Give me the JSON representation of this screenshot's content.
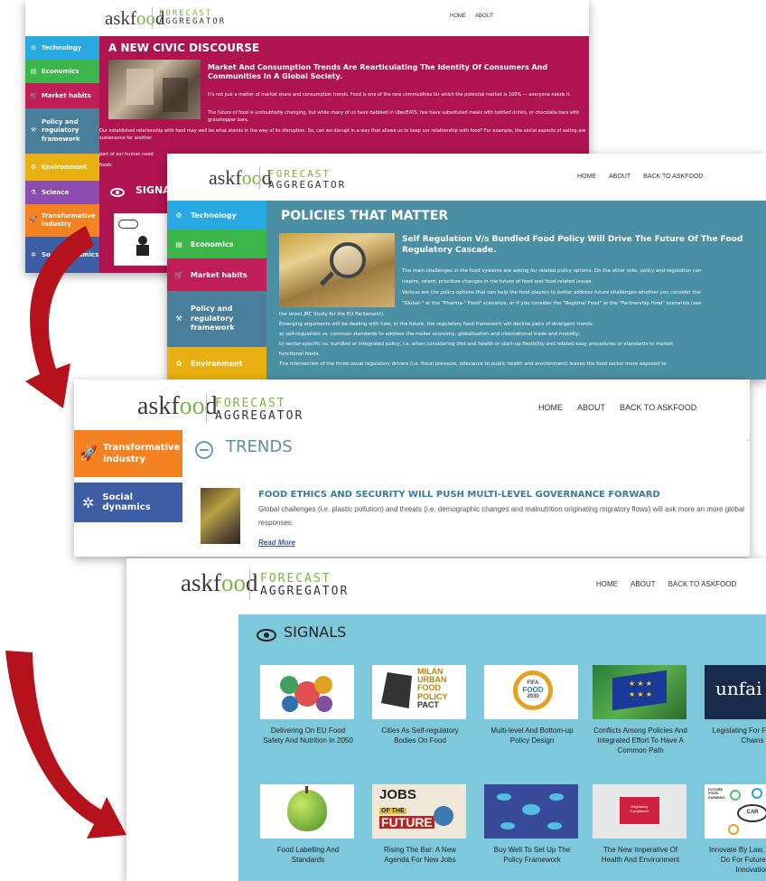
{
  "brand": {
    "ask": "askf",
    "oo": "oo",
    "d": "d",
    "forecast": "FORECAST",
    "aggregator": "AGGREGATOR"
  },
  "nav1": [
    "HOME",
    "ABOUT"
  ],
  "nav": [
    "HOME",
    "ABOUT",
    "BACK TO ASKFOOD"
  ],
  "colors": {
    "civic_bg": "#b01450",
    "policies_bg": "#4a8fa3",
    "signals_bg": "#7ec8dc",
    "tech": "#29a9e1",
    "economics": "#3cb54a",
    "market": "#bf1e56",
    "policy": "#4a7f9c",
    "environment": "#e8b010",
    "science": "#8d4cb0",
    "transform": "#f58220",
    "social": "#3d5da5",
    "arrow": "#b5121b",
    "green": "#7cb342"
  },
  "sidebar1": [
    {
      "label": "Technology",
      "icon": "lightbulb-icon"
    },
    {
      "label": "Economics",
      "icon": "money-icon"
    },
    {
      "label": "Market habits",
      "icon": "cart-icon"
    },
    {
      "label": "Policy and regulatory framework",
      "icon": "gavel-icon"
    },
    {
      "label": "Environment",
      "icon": "recycle-icon"
    },
    {
      "label": "Science",
      "icon": "flask-icon"
    },
    {
      "label": "Transformative industry",
      "icon": "rocket-icon"
    },
    {
      "label": "Social dynamics",
      "icon": "network-icon"
    }
  ],
  "civic": {
    "title": "A NEW CIVIC DISCOURSE",
    "subtitle": "Market And Consumption Trends Are Rearticulating The Identity Of Consumers And Communities In A Global Society.",
    "p1": "It's not just a matter of market share and consumption trends. Food is one of the rare commodities for which the potential market is 100% — everyone needs it.",
    "p2": "The future of food is undoubtedly changing, but while many of us have dabbled in UberEATS, few have substituted meals with bottled drinks, or chocolate bars with grasshopper bars.",
    "p3": "Our established relationship with food may well be what stands in the way of its disruption. So, can we disrupt in a way that allows us to keep our relationship with food? For example, the social aspects of eating are sustenance for another",
    "p4": "part of our human need",
    "p5": "foods.",
    "signals_partial": "SIGNA"
  },
  "policies": {
    "title": "POLICIES THAT MATTER",
    "subtitle": "Self Regulation V/s Bundled Food Policy Will Drive The Future Of The Food Regulatory Cascade.",
    "lines": [
      "The main challenges in the food systems are asking for related policy options. On the other side, policy and regulation can",
      "inspire, orient, prioritize changes in the future of food and food-related issues.",
      "Various are the policy options that can help the food players to better address future challenges whether you consider the",
      "\"Global-\" or the \"Pharma-\" Food\" scenarios, or if you consider the \"Regional Food\" or the \"Partnership Food\" scenarios (see",
      "the latest JRC Study for the EU Parliament).",
      "Emerging arguments will be dealing with how, in the future, the regulatory food framework will decline pairs of divergent trends:",
      "a) self-regulation vs. common standards to address the maker economy, globalisation and international trade and mobility;",
      "b) sector-specific vs. bundled or integrated policy, i.e. when considering diet and health or start-up flexibility and related easy procedures or standards to market",
      "functional foods.",
      "The intersection of the three usual regulatory drivers (i.e. fiscal pressure, relevance to public health and environment) leaves the food sector more exposed to"
    ]
  },
  "sidebar2": [
    {
      "label": "Technology",
      "icon": "lightbulb-icon"
    },
    {
      "label": "Economics",
      "icon": "money-icon"
    },
    {
      "label": "Market habits",
      "icon": "cart-icon"
    },
    {
      "label": "Policy and regulatory framework",
      "icon": "gavel-icon"
    },
    {
      "label": "Environment",
      "icon": "recycle-icon"
    }
  ],
  "sidebar3": [
    {
      "label": "Transformative industry",
      "icon": "rocket-icon"
    },
    {
      "label": "Social dynamics",
      "icon": "network-icon"
    }
  ],
  "trends": {
    "title": "TRENDS",
    "item_title": "FOOD ETHICS AND SECURITY WILL PUSH MULTI-LEVEL GOVERNANCE FORWARD",
    "item_text": "Global challenges (i.e. plastic pollution) and threats (i.e. demographic changes and malnutrition originating migratory flows) will ask more an more global responses.",
    "read_more": "Read More"
  },
  "signals": {
    "title": "SIGNALS",
    "row1": [
      {
        "caption": "Delivering On EU Food Safety And Nutrition In 2050",
        "thumb": "infographic-thumb"
      },
      {
        "caption": "Cities As Self-regulatory Bodies On Food",
        "thumb": "milan-pact-thumb",
        "thumb_text": [
          "MILAN",
          "URBAN",
          "FOOD",
          "POLICY",
          "PACT"
        ]
      },
      {
        "caption": "Multi-level And Bottom-up Policy Design",
        "thumb": "fifa-food-thumb",
        "thumb_text": [
          "FIFA",
          "FOOD",
          "2030"
        ]
      },
      {
        "caption": "Conflicts Among Policies And Integrated Effort To Have A Common Path",
        "thumb": "eu-flag-thumb"
      },
      {
        "caption": "Legislating For Fair Food Chains",
        "thumb": "unfair-thumb",
        "thumb_text": [
          "unfai"
        ]
      }
    ],
    "row2": [
      {
        "caption": "Food Labelling And Standards",
        "thumb": "apple-thumb"
      },
      {
        "caption": "Rising The Bar: A New Agenda For New Jobs",
        "thumb": "jobs-future-thumb",
        "thumb_text": [
          "JOBS",
          "OF THE",
          "FUTURE"
        ]
      },
      {
        "caption": "Buy Well To Set Up The Policy Framework",
        "thumb": "mindmap-thumb"
      },
      {
        "caption": "The New Imperative Of Health And Environment",
        "thumb": "puzzle-thumb",
        "thumb_text": [
          "Regulatory Compliance"
        ]
      },
      {
        "caption": "Innovate By Law, AKIS Will Do For Future Food Innovation",
        "thumb": "future-farming-thumb",
        "thumb_text": [
          "FUTURE FOOD FARMING",
          "CAR"
        ]
      }
    ]
  }
}
